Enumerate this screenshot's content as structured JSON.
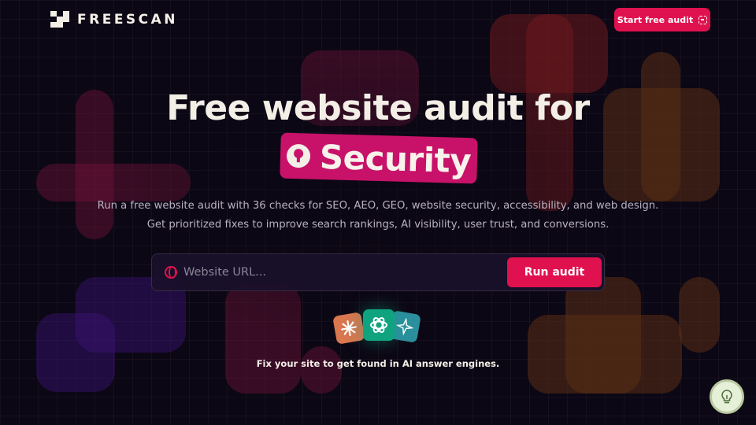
{
  "header": {
    "brand": "FREESCAN",
    "cta_label": "Start free audit",
    "cta_icon": "scan-icon"
  },
  "hero": {
    "title": "Free website audit for",
    "highlight": "Security",
    "highlight_icon": "keyhole-icon",
    "subtitle_line1": "Run a free website audit with 36 checks for SEO, AEO, GEO, website security, accessibility, and web design.",
    "subtitle_line2": "Get prioritized fixes to improve search rankings, AI visibility, user trust, and conversions."
  },
  "search": {
    "placeholder": "Website URL...",
    "value": "",
    "button_label": "Run audit",
    "icon": "globe-icon"
  },
  "ai_engines": {
    "icons": [
      "claude-icon",
      "chatgpt-icon",
      "gemini-icon"
    ],
    "caption": "Fix your site to get found in AI answer engines."
  },
  "floating": {
    "icon": "lightbulb-icon"
  },
  "colors": {
    "background": "#0c0714",
    "accent": "#e0114f",
    "highlight": "#c8126a",
    "text": "#f3efe7"
  }
}
